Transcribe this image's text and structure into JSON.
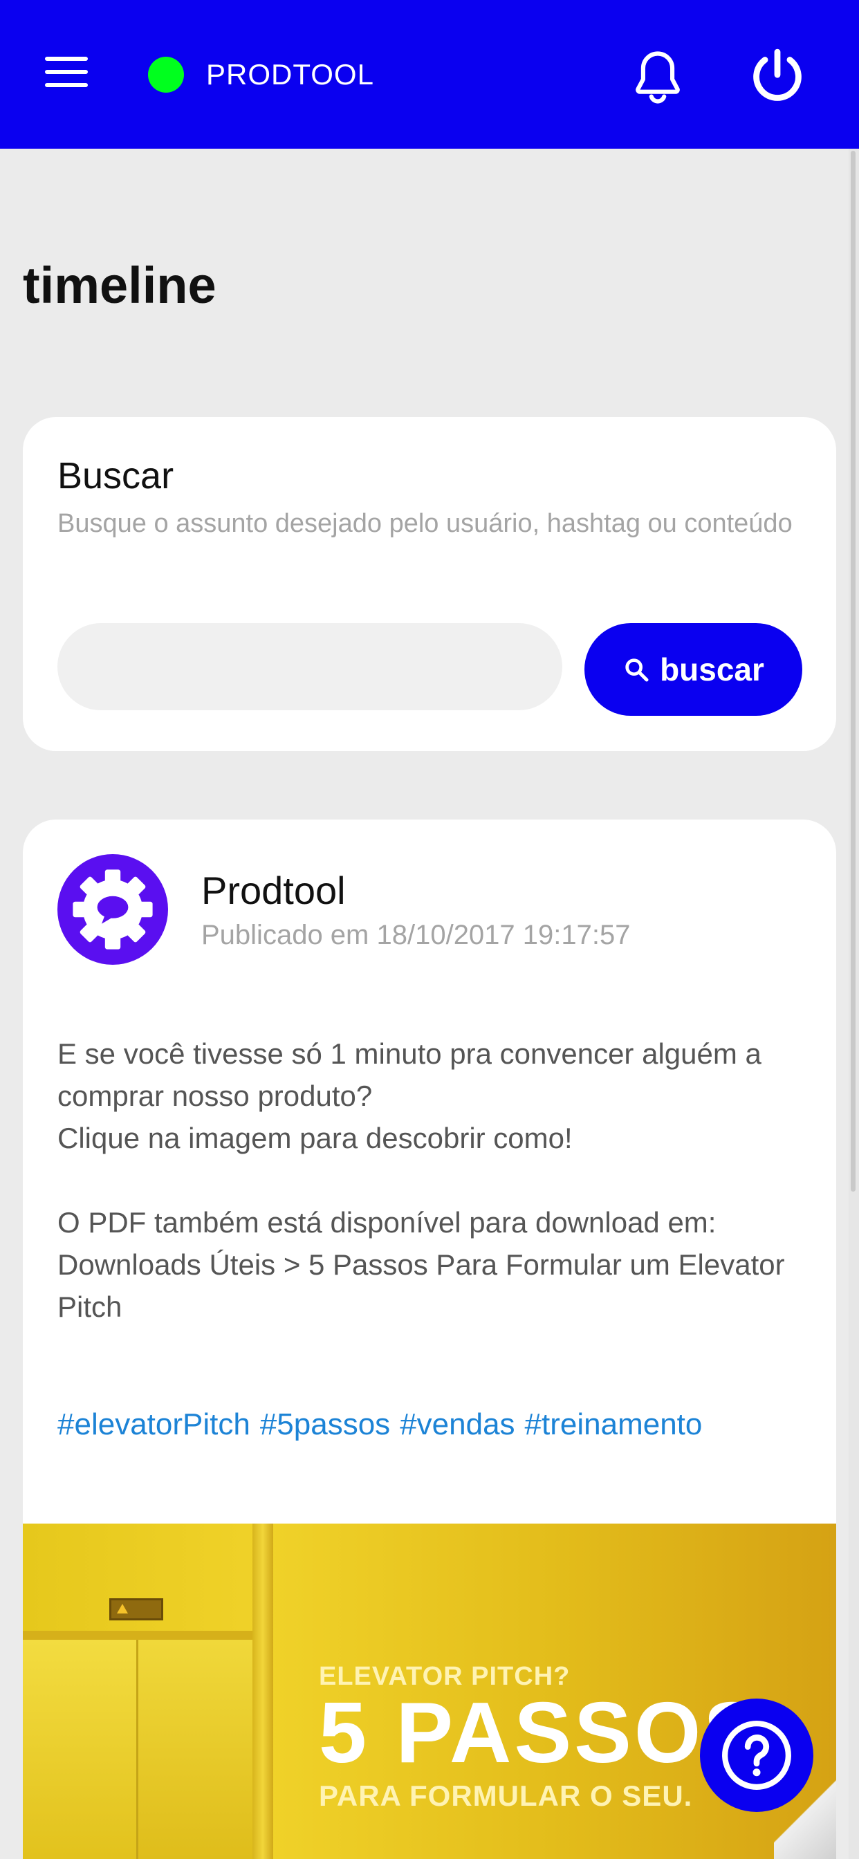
{
  "header": {
    "app_title": "PRODTOOL",
    "status_color": "#00ff1e",
    "accent_color": "#0a00f0",
    "icons": [
      "menu-icon",
      "bell-icon",
      "power-icon"
    ]
  },
  "page": {
    "title": "timeline"
  },
  "search": {
    "title": "Buscar",
    "subtitle": "Busque o assunto desejado pelo usuário, hashtag ou conteúdo",
    "input_value": "",
    "input_placeholder": "",
    "button_label": "buscar",
    "button_icon": "search-icon"
  },
  "post": {
    "author": "Prodtool",
    "published": "Publicado em 18/10/2017 19:17:57",
    "body": "E se você tivesse só 1 minuto pra convencer alguém a comprar nosso produto?\nClique na imagem para descobrir como!\n\nO PDF também está disponível para download em:\nDownloads Úteis > 5 Passos Para Formular um Elevator Pitch",
    "hashtags": [
      "#elevatorPitch",
      "#5passos",
      "#vendas",
      "#treinamento"
    ],
    "image": {
      "line1": "ELEVATOR PITCH?",
      "line2": "5 PASSOS",
      "line3": "PARA FORMULAR O SEU."
    }
  },
  "help_button": {
    "icon": "question-mark-icon"
  }
}
